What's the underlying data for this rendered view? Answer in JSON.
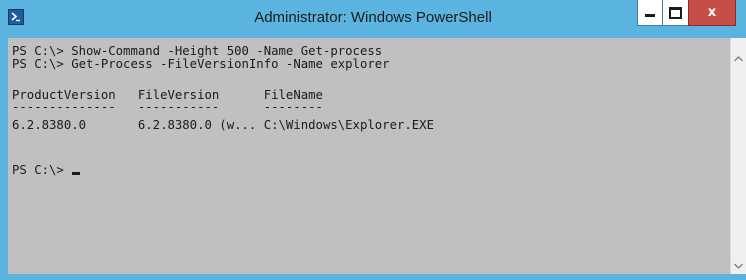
{
  "window": {
    "title": "Administrator: Windows PowerShell",
    "frame_color": "#5bb4df",
    "console_background": "#c0c0c0",
    "icon": "powershell-icon",
    "controls": {
      "minimize_icon": "minimize-icon",
      "maximize_icon": "maximize-icon",
      "close_symbol": "x",
      "close_color": "#c74d47"
    }
  },
  "console": {
    "lines": [
      "PS C:\\> Show-Command -Height 500 -Name Get-process",
      "PS C:\\> Get-Process -FileVersionInfo -Name explorer",
      "",
      "ProductVersion   FileVersion      FileName",
      "--------------   -----------      --------",
      "6.2.8380.0       6.2.8380.0 (w... C:\\Windows\\Explorer.EXE",
      "",
      "",
      "PS C:\\> "
    ],
    "cursor": "_"
  },
  "scrollbar": {
    "up_arrow": "chevron-up-icon",
    "down_arrow": "chevron-down-icon"
  }
}
